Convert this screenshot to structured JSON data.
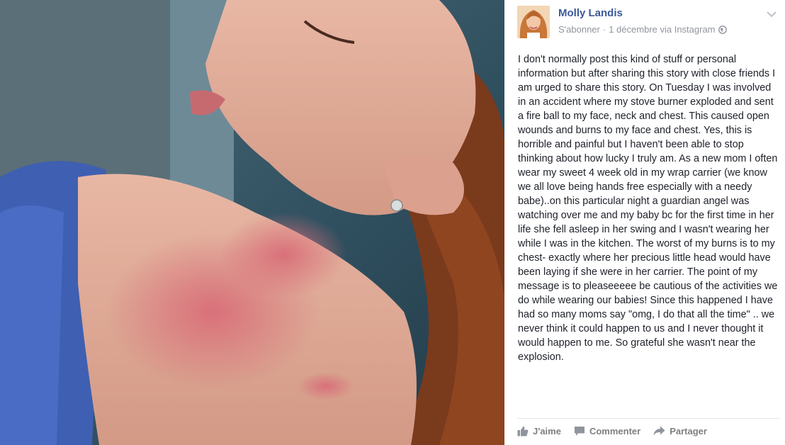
{
  "post": {
    "author": "Molly Landis",
    "subscribe_label": "S'abonner",
    "separator": "·",
    "timestamp": "1 décembre via Instagram",
    "body": "I don't normally post this kind of stuff or personal information but after sharing this story with close friends I am urged to share this story. On Tuesday I was involved in an accident where my stove burner exploded and sent a fire ball to my face, neck and chest. This caused open wounds and burns to my face and chest. Yes, this is horrible and painful but I haven't been able to stop thinking about how lucky I truly am. As a new mom I often wear my sweet 4 week old in my wrap carrier (we know we all love being hands free especially with a needy babe)..on this particular night a guardian angel was watching over me and my baby bc for the first time in her life she fell asleep in her swing and I wasn't wearing her while I was in the kitchen. The worst of my burns is to my chest- exactly where her precious little head would have been laying if she were in her carrier. The point of my message is to pleaseeeee be cautious of the activities we do while wearing our babies! Since this happened I have had so many moms say \"omg, I do that all the time\" .. we never think it could happen to us and I never thought it would happen to me. So grateful she wasn't near the explosion."
  },
  "actions": {
    "like_label": "J'aime",
    "comment_label": "Commenter",
    "share_label": "Partager"
  },
  "icons": {
    "visibility": "globe-icon",
    "options": "chevron-down-icon",
    "like": "thumbs-up-icon",
    "comment": "comment-bubble-icon",
    "share": "share-arrow-icon"
  },
  "colors": {
    "author_link": "#3b5998",
    "meta_text": "#90949c",
    "body_text": "#1d2129",
    "action_text": "#7f7f7f"
  }
}
